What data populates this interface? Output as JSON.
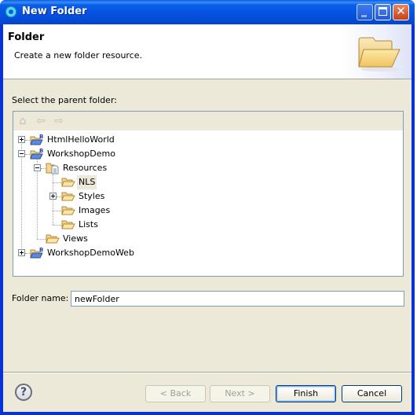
{
  "window": {
    "title": "New Folder",
    "controls": {
      "minimize": "minimize",
      "maximize": "maximize",
      "close": "✕"
    }
  },
  "header": {
    "title": "Folder",
    "description": "Create a new folder resource."
  },
  "tree": {
    "label": "Select the parent folder:",
    "toolbar": [
      {
        "name": "home-icon",
        "glyph": "⌂"
      },
      {
        "name": "back-arrow-icon",
        "glyph": "⇦"
      },
      {
        "name": "forward-arrow-icon",
        "glyph": "⇨"
      }
    ],
    "nodes": [
      {
        "label": "HtmlHelloWorld",
        "depth": 0,
        "type": "project",
        "expander": "plus"
      },
      {
        "label": "WorkshopDemo",
        "depth": 0,
        "type": "project",
        "expander": "minus"
      },
      {
        "label": "Resources",
        "depth": 1,
        "type": "resources",
        "expander": "minus"
      },
      {
        "label": "NLS",
        "depth": 2,
        "type": "folder",
        "expander": "none",
        "selected": true
      },
      {
        "label": "Styles",
        "depth": 2,
        "type": "folder",
        "expander": "plus"
      },
      {
        "label": "Images",
        "depth": 2,
        "type": "folder",
        "expander": "none"
      },
      {
        "label": "Lists",
        "depth": 2,
        "type": "folder",
        "expander": "none"
      },
      {
        "label": "Views",
        "depth": 1,
        "type": "folder",
        "expander": "none"
      },
      {
        "label": "WorkshopDemoWeb",
        "depth": 0,
        "type": "project",
        "expander": "plus"
      }
    ]
  },
  "folder_name": {
    "label": "Folder name:",
    "value": "newFolder"
  },
  "buttons": {
    "help": "?",
    "back": "< Back",
    "next": "Next >",
    "finish": "Finish",
    "cancel": "Cancel"
  },
  "colors": {
    "titlebar": "#0551e0",
    "dialog_bg": "#ece9d8",
    "border_blue": "#7f9db9",
    "folder_yellow": "#f6d68a"
  }
}
